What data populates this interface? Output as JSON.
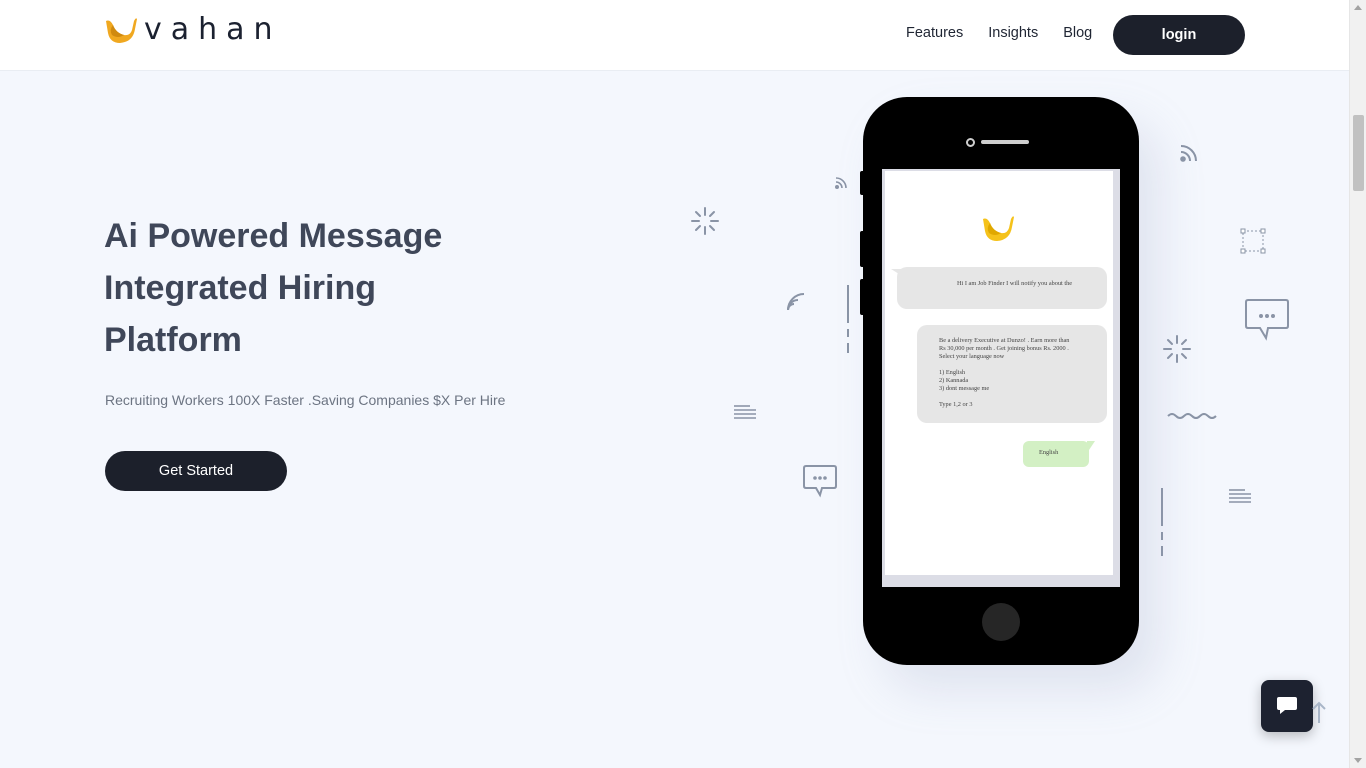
{
  "brand": {
    "name": "vahan",
    "logo_color": "#f0a820"
  },
  "nav": {
    "items": [
      "Features",
      "Insights",
      "Blog"
    ],
    "login_label": "login"
  },
  "hero": {
    "title_lines": [
      "Ai Powered Message",
      "Integrated Hiring",
      "Platform"
    ],
    "subtitle": "Recruiting Workers 100X Faster .Saving Companies $X Per Hire",
    "cta_label": "Get Started"
  },
  "phone_chat": {
    "bot_greeting": "Hi I am Job Finder I will notify you about the",
    "job_message_lines": [
      "Be a delivery Executive at Dunzo! . Earn more than",
      "Rs 30,000 per month . Get joining bonus Rs. 2000 .",
      "Select your language now"
    ],
    "options": [
      "1) English",
      "2) Kannada",
      "3) dont message me"
    ],
    "prompt": "Type 1,2 or 3",
    "user_reply": "English"
  },
  "chat_widget": {
    "icon": "chat-bubble-icon"
  },
  "colors": {
    "dark": "#1c202b",
    "background": "#f4f7fd",
    "reply_bubble": "#d3f0c4",
    "bot_bubble": "#e6e6e6"
  }
}
